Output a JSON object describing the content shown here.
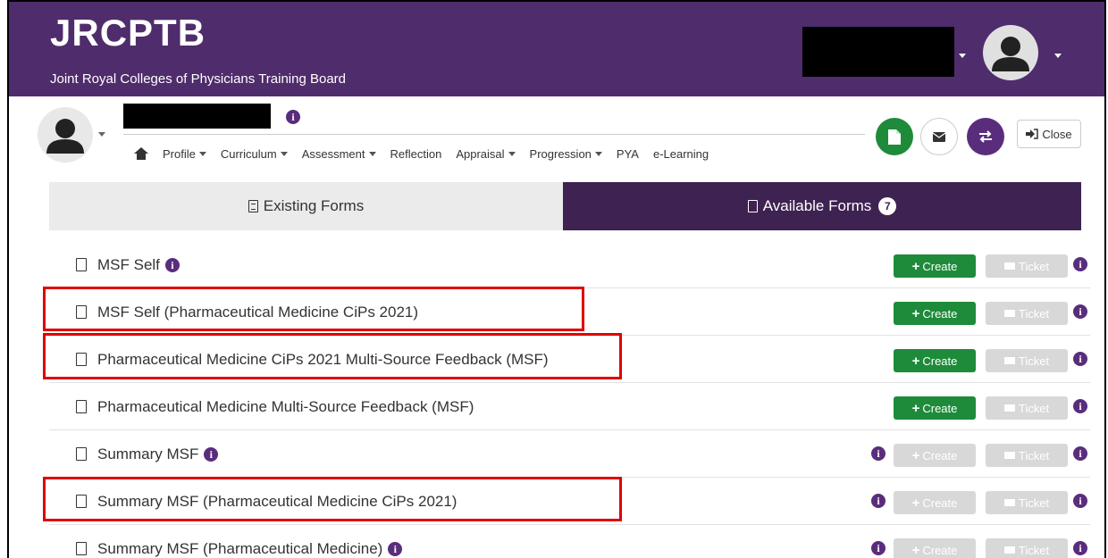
{
  "header": {
    "logo": "JRCPTB",
    "subtitle": "Joint Royal Colleges of Physicians Training Board"
  },
  "nav": {
    "items": [
      {
        "label": "Profile",
        "dropdown": true
      },
      {
        "label": "Curriculum",
        "dropdown": true
      },
      {
        "label": "Assessment",
        "dropdown": true
      },
      {
        "label": "Reflection",
        "dropdown": false
      },
      {
        "label": "Appraisal",
        "dropdown": true
      },
      {
        "label": "Progression",
        "dropdown": true
      },
      {
        "label": "PYA",
        "dropdown": false
      },
      {
        "label": "e-Learning",
        "dropdown": false
      }
    ],
    "close_label": "Close"
  },
  "tabs": {
    "existing": "Existing Forms",
    "available": "Available Forms",
    "available_count": "7"
  },
  "buttons": {
    "create": "Create",
    "ticket": "Ticket"
  },
  "forms": [
    {
      "label": "MSF Self",
      "info": true,
      "create_enabled": true,
      "left_info": false
    },
    {
      "label": "MSF Self (Pharmaceutical Medicine CiPs 2021)",
      "info": false,
      "create_enabled": true,
      "left_info": false
    },
    {
      "label": "Pharmaceutical Medicine CiPs 2021 Multi-Source Feedback (MSF)",
      "info": false,
      "create_enabled": true,
      "left_info": false
    },
    {
      "label": "Pharmaceutical Medicine Multi-Source Feedback (MSF)",
      "info": false,
      "create_enabled": true,
      "left_info": false
    },
    {
      "label": "Summary MSF",
      "info": true,
      "create_enabled": false,
      "left_info": true
    },
    {
      "label": "Summary MSF (Pharmaceutical Medicine CiPs 2021)",
      "info": false,
      "create_enabled": false,
      "left_info": true
    },
    {
      "label": "Summary MSF (Pharmaceutical Medicine)",
      "info": true,
      "create_enabled": false,
      "left_info": true
    }
  ],
  "colors": {
    "brand_purple": "#4f2c6b",
    "tab_dark": "#3e2251",
    "create_green": "#1e8b3a",
    "disabled_gray": "#d8d8d8",
    "highlight_red": "#e00000"
  },
  "icons": {
    "home": "home-icon",
    "document": "document-icon",
    "info": "info-icon",
    "mail": "envelope-icon",
    "switch": "swap-icon",
    "close": "sign-out-icon"
  }
}
